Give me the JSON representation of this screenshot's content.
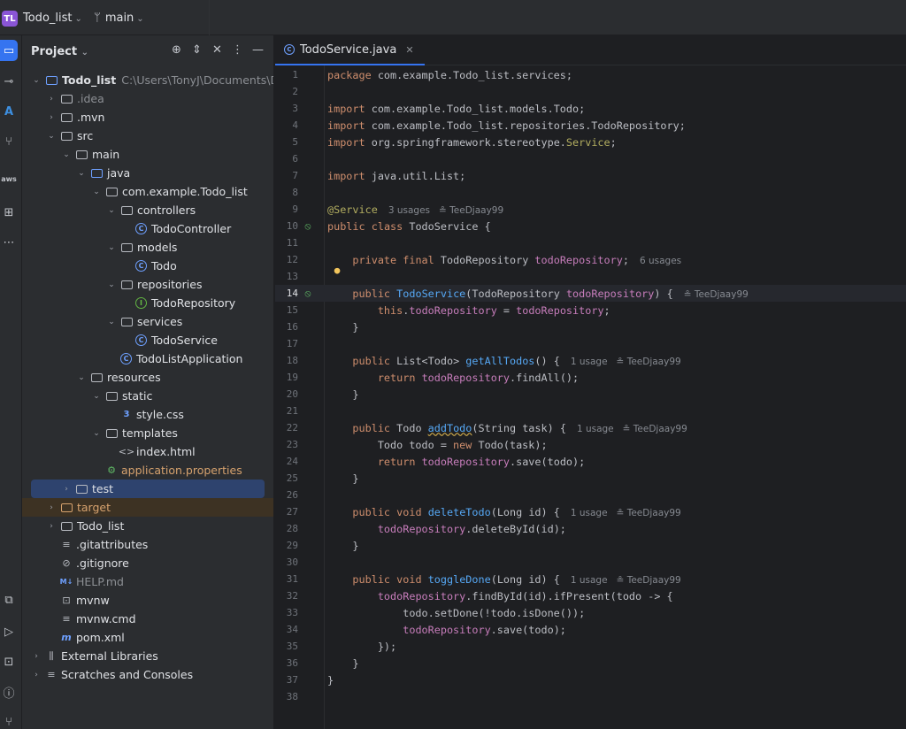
{
  "titlebar": {
    "project_badge": "TL",
    "project_name": "Todo_list",
    "branch": "main"
  },
  "project_panel": {
    "title": "Project",
    "tree": [
      {
        "label": "Todo_list",
        "path": "C:\\Users\\TonyJ\\Documents\\DEV"
      },
      {
        "label": ".idea"
      },
      {
        "label": ".mvn"
      },
      {
        "label": "src"
      },
      {
        "label": "main"
      },
      {
        "label": "java"
      },
      {
        "label": "com.example.Todo_list"
      },
      {
        "label": "controllers"
      },
      {
        "label": "TodoController"
      },
      {
        "label": "models"
      },
      {
        "label": "Todo"
      },
      {
        "label": "repositories"
      },
      {
        "label": "TodoRepository"
      },
      {
        "label": "services"
      },
      {
        "label": "TodoService"
      },
      {
        "label": "TodoListApplication"
      },
      {
        "label": "resources"
      },
      {
        "label": "static"
      },
      {
        "label": "style.css"
      },
      {
        "label": "templates"
      },
      {
        "label": "index.html"
      },
      {
        "label": "application.properties"
      },
      {
        "label": "test"
      },
      {
        "label": "target"
      },
      {
        "label": "Todo_list"
      },
      {
        "label": ".gitattributes"
      },
      {
        "label": ".gitignore"
      },
      {
        "label": "HELP.md"
      },
      {
        "label": "mvnw"
      },
      {
        "label": "mvnw.cmd"
      },
      {
        "label": "pom.xml"
      },
      {
        "label": "External Libraries"
      },
      {
        "label": "Scratches and Consoles"
      }
    ]
  },
  "editor": {
    "tab_label": "TodoService.java",
    "current_line": 14,
    "lines": [
      {
        "n": "1",
        "c": "package com.example.Todo_list.services;"
      },
      {
        "n": "2",
        "c": ""
      },
      {
        "n": "3",
        "c": "import com.example.Todo_list.models.Todo;"
      },
      {
        "n": "4",
        "c": "import com.example.Todo_list.repositories.TodoRepository;"
      },
      {
        "n": "5",
        "c": "import org.springframework.stereotype.Service;"
      },
      {
        "n": "6",
        "c": ""
      },
      {
        "n": "7",
        "c": "import java.util.List;"
      },
      {
        "n": "8",
        "c": ""
      },
      {
        "n": "9",
        "c": "@Service",
        "hint": "3 usages   ≗ TeeDjaay99"
      },
      {
        "n": "10",
        "c": "public class TodoService {"
      },
      {
        "n": "11",
        "c": ""
      },
      {
        "n": "12",
        "c": "    private final TodoRepository todoRepository;",
        "hint": "6 usages"
      },
      {
        "n": "13",
        "c": ""
      },
      {
        "n": "14",
        "c": "    public TodoService(TodoRepository todoRepository) {",
        "hint": "≗ TeeDjaay99"
      },
      {
        "n": "15",
        "c": "        this.todoRepository = todoRepository;"
      },
      {
        "n": "16",
        "c": "    }"
      },
      {
        "n": "17",
        "c": ""
      },
      {
        "n": "18",
        "c": "    public List<Todo> getAllTodos() {",
        "hint": "1 usage   ≗ TeeDjaay99"
      },
      {
        "n": "19",
        "c": "        return todoRepository.findAll();"
      },
      {
        "n": "20",
        "c": "    }"
      },
      {
        "n": "21",
        "c": ""
      },
      {
        "n": "22",
        "c": "    public Todo addTodo(String task) {",
        "hint": "1 usage   ≗ TeeDjaay99"
      },
      {
        "n": "23",
        "c": "        Todo todo = new Todo(task);"
      },
      {
        "n": "24",
        "c": "        return todoRepository.save(todo);"
      },
      {
        "n": "25",
        "c": "    }"
      },
      {
        "n": "26",
        "c": ""
      },
      {
        "n": "27",
        "c": "    public void deleteTodo(Long id) {",
        "hint": "1 usage   ≗ TeeDjaay99"
      },
      {
        "n": "28",
        "c": "        todoRepository.deleteById(id);"
      },
      {
        "n": "29",
        "c": "    }"
      },
      {
        "n": "30",
        "c": ""
      },
      {
        "n": "31",
        "c": "    public void toggleDone(Long id) {",
        "hint": "1 usage   ≗ TeeDjaay99"
      },
      {
        "n": "32",
        "c": "        todoRepository.findById(id).ifPresent(todo -> {"
      },
      {
        "n": "33",
        "c": "            todo.setDone(!todo.isDone());"
      },
      {
        "n": "34",
        "c": "            todoRepository.save(todo);"
      },
      {
        "n": "35",
        "c": "        });"
      },
      {
        "n": "36",
        "c": "    }"
      },
      {
        "n": "37",
        "c": "}"
      },
      {
        "n": "38",
        "c": ""
      }
    ]
  }
}
